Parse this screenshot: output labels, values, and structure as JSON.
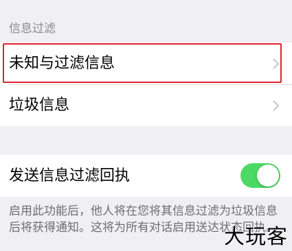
{
  "section": {
    "header": "信息过滤"
  },
  "rows": {
    "unknown_filter": {
      "label": "未知与过滤信息"
    },
    "junk": {
      "label": "垃圾信息"
    }
  },
  "toggle_row": {
    "label": "发送信息过滤回执",
    "state": "on",
    "on_color": "#4cd964"
  },
  "footer": {
    "text": "启用此功能后，他人将在您将其信息过滤为垃圾信息后将获得通知。这将为所有对话启用送达状态回执。"
  },
  "watermark": {
    "text": "大玩客"
  },
  "icons": {
    "chevron": "chevron-right-icon"
  },
  "colors": {
    "highlight": "#e0212e",
    "background": "#efeff4"
  }
}
